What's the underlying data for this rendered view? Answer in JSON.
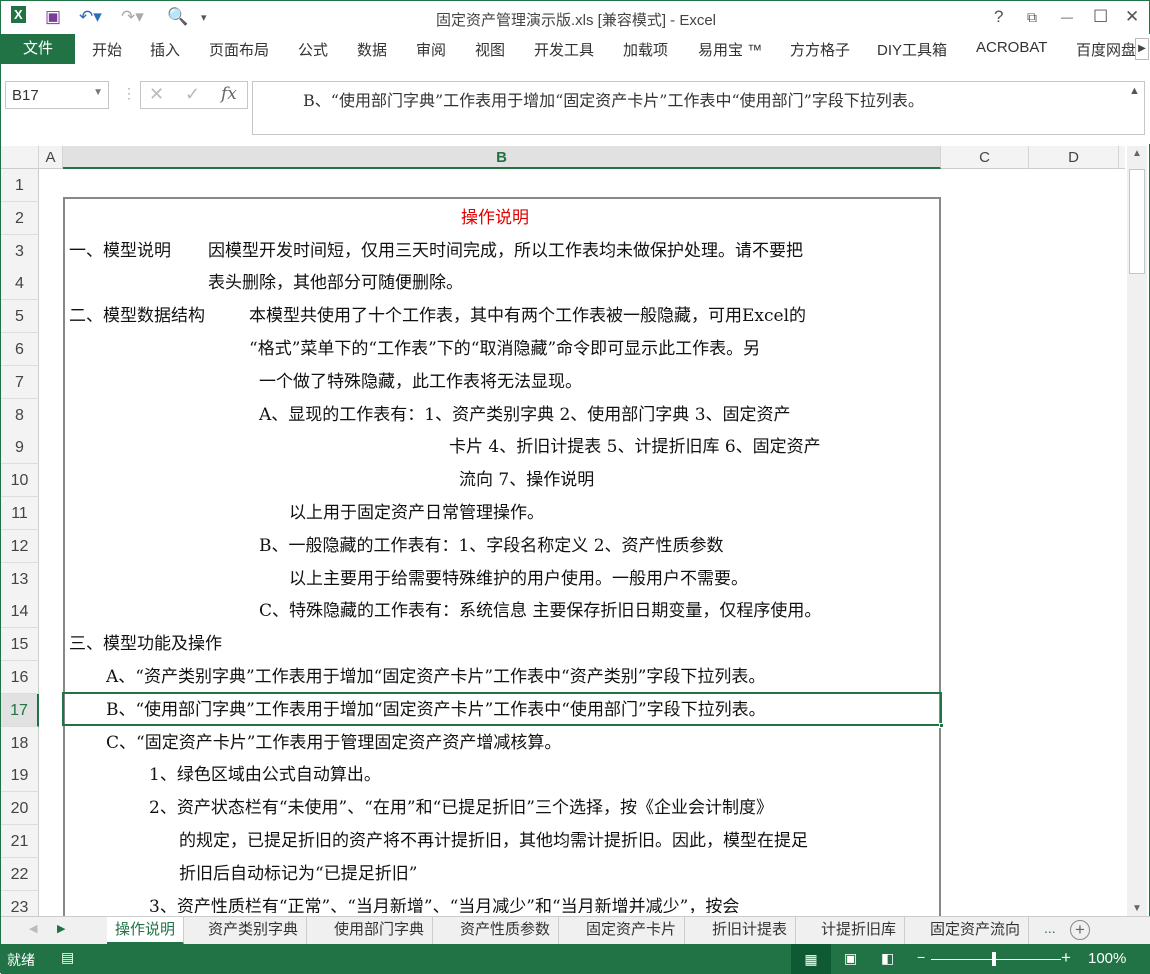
{
  "window": {
    "title": "固定资产管理演示版.xls  [兼容模式] - Excel",
    "help": "?",
    "restore": "⧉",
    "minimize": "—",
    "maximize": "☐",
    "close": "✕"
  },
  "ribbon": {
    "file": "文件",
    "tabs": [
      "开始",
      "插入",
      "页面布局",
      "公式",
      "数据",
      "审阅",
      "视图",
      "开发工具",
      "加载项",
      "易用宝 ™",
      "方方格子",
      "DIY工具箱",
      "ACROBAT",
      "百度网盘"
    ]
  },
  "formula_bar": {
    "name_box": "B17",
    "formula": "B、“使用部门字典”工作表用于增加“固定资产卡片”工作表中“使用部门”字段下拉列表。"
  },
  "columns": [
    "A",
    "B",
    "C",
    "D"
  ],
  "rows": [
    "1",
    "2",
    "3",
    "4",
    "5",
    "6",
    "7",
    "8",
    "9",
    "10",
    "11",
    "12",
    "13",
    "14",
    "15",
    "16",
    "17",
    "18",
    "19",
    "20",
    "21",
    "22",
    "23"
  ],
  "cells": {
    "r2": "操作说明",
    "r3a": "一、模型说明",
    "r3b": "因模型开发时间短，仅用三天时间完成，所以工作表均未做保护处理。请不要把",
    "r4": "表头删除，其他部分可随便删除。",
    "r5a": "二、模型数据结构",
    "r5b": "本模型共使用了十个工作表，其中有两个工作表被一般隐藏，可用Excel的",
    "r6": "“格式”菜单下的“工作表”下的“取消隐藏”命令即可显示此工作表。另",
    "r7": "一个做了特殊隐藏，此工作表将无法显现。",
    "r8": "A、显现的工作表有：1、资产类别字典  2、使用部门字典  3、固定资产",
    "r9": "卡片  4、折旧计提表  5、计提折旧库  6、固定资产",
    "r10": "流向 7、操作说明",
    "r11": "以上用于固定资产日常管理操作。",
    "r12": "B、一般隐藏的工作表有：1、字段名称定义  2、资产性质参数",
    "r13": "以上主要用于给需要特殊维护的用户使用。一般用户不需要。",
    "r14": "C、特殊隐藏的工作表有：系统信息  主要保存折旧日期变量，仅程序使用。",
    "r15": "三、模型功能及操作",
    "r16": "A、“资产类别字典”工作表用于增加“固定资产卡片”工作表中“资产类别”字段下拉列表。",
    "r17": "B、“使用部门字典”工作表用于增加“固定资产卡片”工作表中“使用部门”字段下拉列表。",
    "r18": "C、“固定资产卡片”工作表用于管理固定资产资产增减核算。",
    "r19": "1、绿色区域由公式自动算出。",
    "r20": "2、资产状态栏有“未使用”、“在用”和“已提足折旧”三个选择，按《企业会计制度》",
    "r21": "的规定，已提足折旧的资产将不再计提折旧，其他均需计提折旧。因此，模型在提足",
    "r22": "折旧后自动标记为“已提足折旧”",
    "r23": "3、资产性质栏有“正常”、“当月新增”、“当月减少”和“当月新增并减少”，按会"
  },
  "sheet_tabs": [
    "操作说明",
    "资产类别字典",
    "使用部门字典",
    "资产性质参数",
    "固定资产卡片",
    "折旧计提表",
    "计提折旧库",
    "固定资产流向",
    "..."
  ],
  "status": {
    "ready": "就绪",
    "zoom": "100%"
  },
  "colors": {
    "accent": "#217346",
    "title_red": "#e00000"
  }
}
